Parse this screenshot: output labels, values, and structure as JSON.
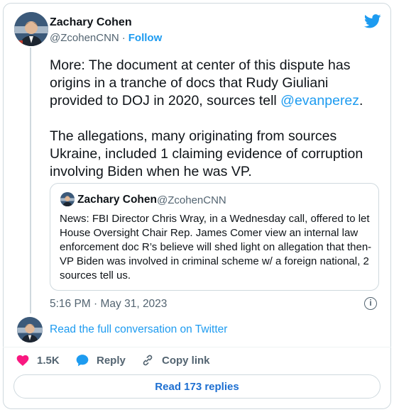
{
  "author": {
    "name": "Zachary Cohen",
    "handle": "@ZcohenCNN",
    "separator": "·",
    "follow_label": "Follow"
  },
  "tweet": {
    "paragraph1_before": "More: The document at center of this dispute has origins in a tranche of docs that Rudy Giuliani provided to DOJ in 2020, sources tell ",
    "paragraph1_mention": "@evanperez",
    "paragraph1_after": ".",
    "paragraph2": "The allegations, many originating from sources Ukraine, included 1 claiming evidence of corruption involving Biden when he was VP."
  },
  "quoted_tweet": {
    "name": "Zachary Cohen",
    "handle": "@ZcohenCNN",
    "text": "News: FBI Director Chris Wray, in a Wednesday call, offered to let House Oversight Chair Rep. James Comer view an internal law enforcement doc R’s believe will shed light on allegation that then-VP Biden was involved in criminal scheme w/ a foreign national, 2 sources tell us."
  },
  "timestamp": "5:16 PM · May 31, 2023",
  "info_icon_glyph": "i",
  "read_full_label": "Read the full conversation on Twitter",
  "actions": {
    "like_count": "1.5K",
    "reply_label": "Reply",
    "copy_label": "Copy link"
  },
  "read_replies_label": "Read 173 replies",
  "colors": {
    "accent": "#1d9bf0",
    "like": "#f91880",
    "secondary_text": "#536471",
    "border": "#cfd9de"
  },
  "icons": [
    "twitter-bird-icon",
    "info-icon",
    "heart-icon",
    "reply-bubble-icon",
    "link-icon"
  ]
}
